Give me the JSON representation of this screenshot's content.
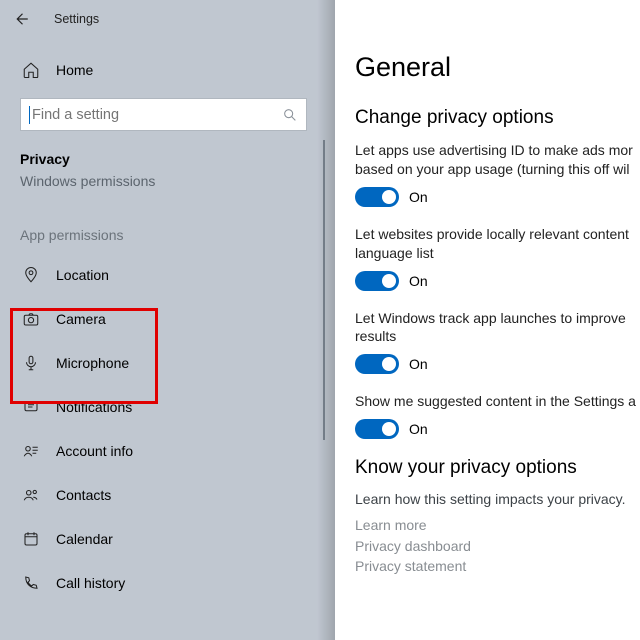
{
  "window": {
    "title": "Settings"
  },
  "sidebar": {
    "home": "Home",
    "search_placeholder": "Find a setting",
    "section": "Privacy",
    "sub": "Windows permissions",
    "app_header": "App permissions",
    "items": [
      {
        "label": "Location"
      },
      {
        "label": "Camera"
      },
      {
        "label": "Microphone"
      },
      {
        "label": "Notifications"
      },
      {
        "label": "Account info"
      },
      {
        "label": "Contacts"
      },
      {
        "label": "Calendar"
      },
      {
        "label": "Call history"
      }
    ]
  },
  "main": {
    "h1": "General",
    "h2": "Change privacy options",
    "options": [
      {
        "desc": "Let apps use advertising ID to make ads mor​\nbased on your app usage (turning this off wil",
        "state": "On"
      },
      {
        "desc": "Let websites provide locally relevant content\nlanguage list",
        "state": "On"
      },
      {
        "desc": "Let Windows track app launches to improve ​\nresults",
        "state": "On"
      },
      {
        "desc": "Show me suggested content in the Settings a",
        "state": "On"
      }
    ],
    "know": {
      "h": "Know your privacy options",
      "sub": "Learn how this setting impacts your privacy.",
      "links": [
        "Learn more",
        "Privacy dashboard",
        "Privacy statement"
      ]
    }
  }
}
